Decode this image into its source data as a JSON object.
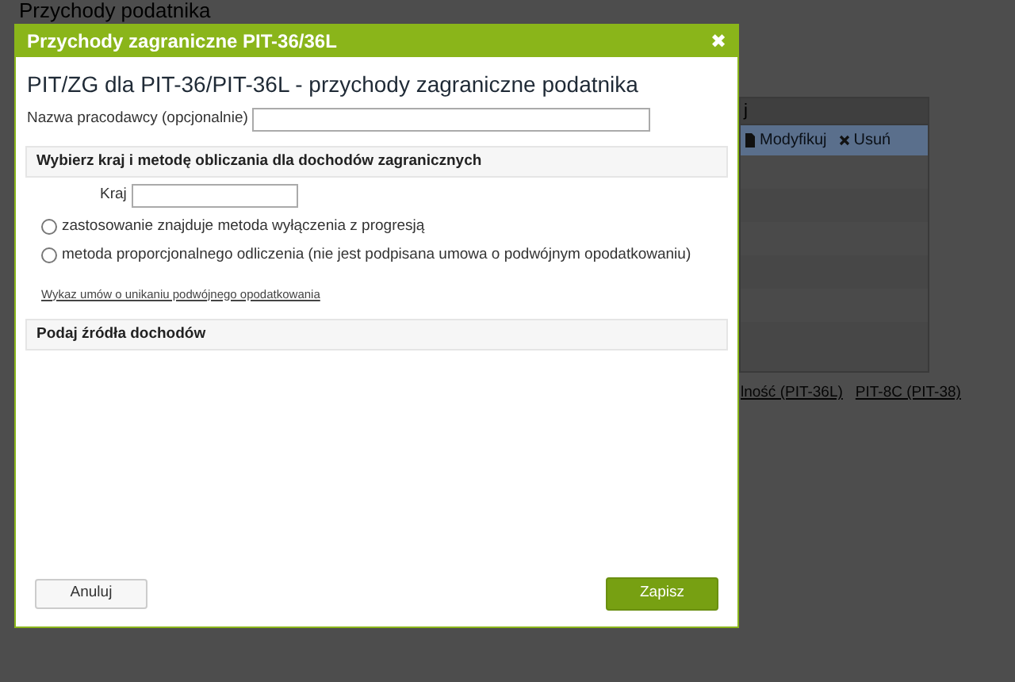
{
  "background_page": {
    "title": "Przychody podatnika",
    "table": {
      "header": "j",
      "rows": [
        {
          "actions": [
            "Modyfikuj",
            "Usuń"
          ],
          "selected": true
        }
      ]
    },
    "links": [
      "lność (PIT-36L)",
      "PIT-8C (PIT-38)"
    ]
  },
  "dialog": {
    "title": "Przychody zagraniczne PIT-36/36L",
    "close": "✖",
    "heading": "PIT/ZG dla PIT-36/PIT-36L - przychody zagraniczne podatnika",
    "employer_field": {
      "label": "Nazwa pracodawcy (opcjonalnie)"
    },
    "sections": [
      {
        "title": "Wybierz kraj i metodę obliczania dla dochodów zagranicznych",
        "country_label": "Kraj",
        "methods": [
          {
            "label": "zastosowanie znajduje metoda wyłączenia z progresją",
            "selected": false
          },
          {
            "label": "metoda proporcjonalnego odliczenia (nie jest podpisana umowa o podwójnym opodatkowaniu)",
            "selected": false
          }
        ],
        "link": "Wykaz umów o unikaniu podwójnego opodatkowania"
      },
      {
        "title": "Podaj źródła dochodów"
      }
    ],
    "buttons": {
      "cancel": "Anuluj",
      "save": "Zapisz"
    }
  }
}
